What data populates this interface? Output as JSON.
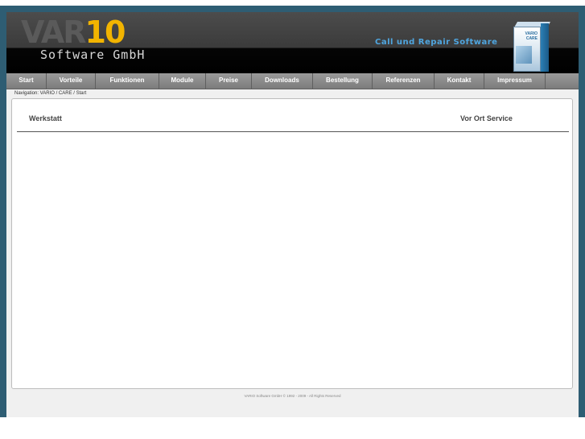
{
  "header": {
    "logo_var": "VAR",
    "logo_10": "10",
    "logo_sub": "Software GmbH",
    "tagline": "Call und Repair Software",
    "box_label": "VARIO CARE"
  },
  "nav": {
    "items": [
      {
        "label": "Start"
      },
      {
        "label": "Vorteile"
      },
      {
        "label": "Funktionen"
      },
      {
        "label": "Module"
      },
      {
        "label": "Preise"
      },
      {
        "label": "Downloads"
      },
      {
        "label": "Bestellung"
      },
      {
        "label": "Referenzen"
      },
      {
        "label": "Kontakt"
      },
      {
        "label": "Impressum"
      }
    ]
  },
  "breadcrumb": "Navigation: VARIO / CARE / Start",
  "content": {
    "left_heading": "Werkstatt",
    "right_heading": "Vor Ort Service"
  },
  "footer": "VARIO Software GmbH © 1992 - 2009 - All Rights Reserved",
  "colors": {
    "frame": "#2e5d73",
    "logo_accent": "#f2b400",
    "tagline": "#4fa6e0"
  }
}
